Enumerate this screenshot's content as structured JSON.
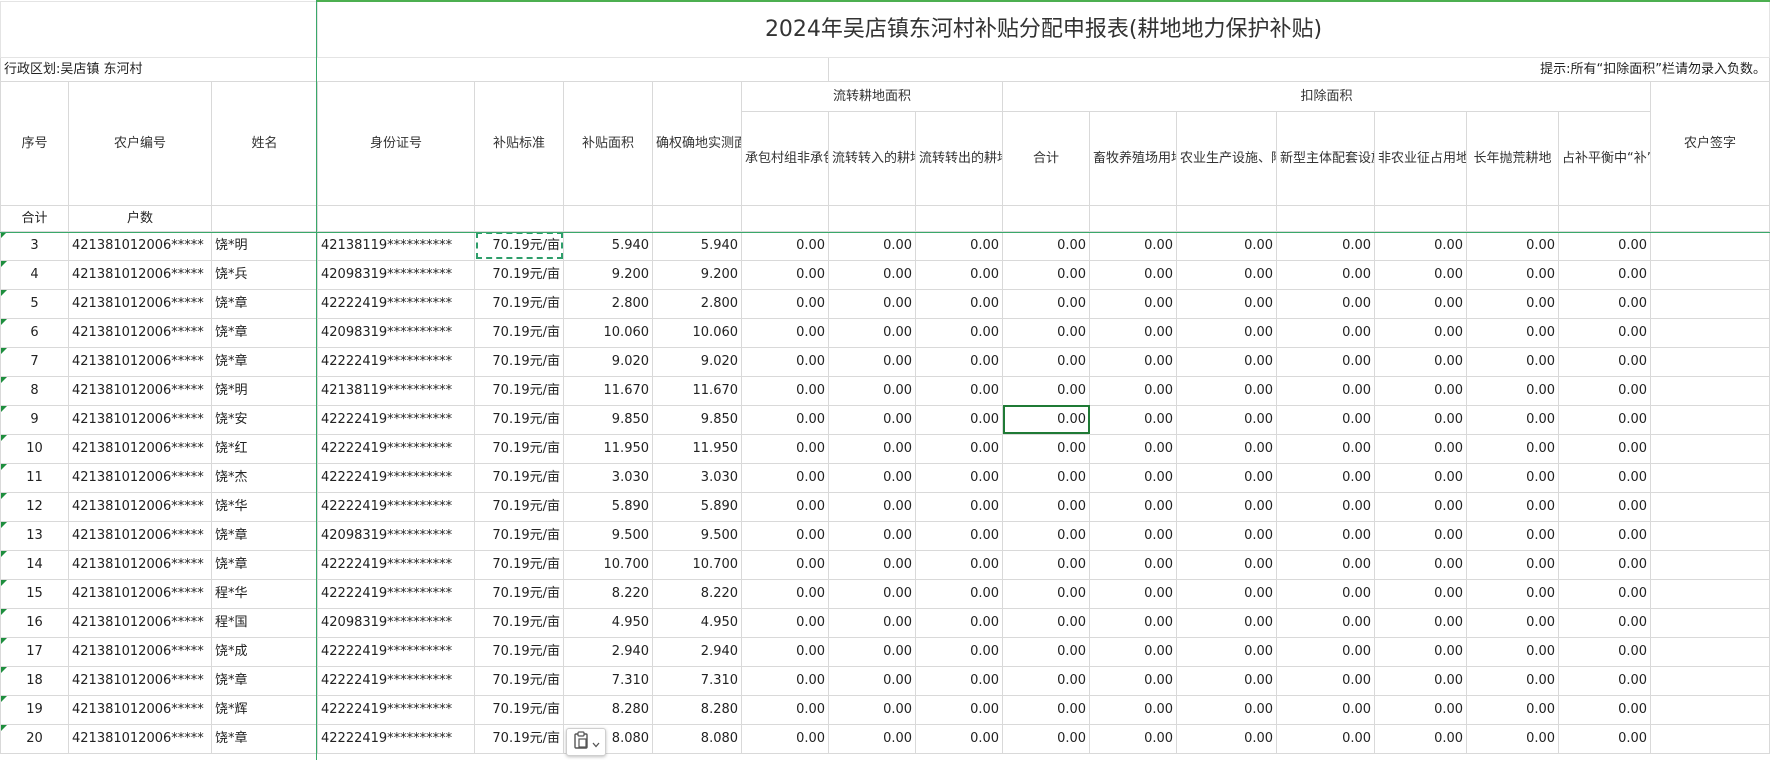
{
  "title": "2024年吴店镇东河村补贴分配申报表(耕地地力保护补贴)",
  "admin_region": "行政区划:吴店镇 东河村",
  "hint": "提示:所有“扣除面积”栏请勿录入负数。",
  "headers": {
    "seq": "序号",
    "farmer_code": "农户编号",
    "name": "姓名",
    "id_number": "身份证号",
    "subsidy_std": "补贴标准",
    "subsidy_area": "补贴面积",
    "measured_area": "确权确地实测面积",
    "transfer_group": "流转耕地面积",
    "transfer_cols": [
      "承包村组非承包地",
      "流转转入的耕地",
      "流转转出的耕地"
    ],
    "deduct_group": "扣除面积",
    "deduct_cols": [
      "合计",
      "畜牧养殖场用地",
      "农业生产设施、附属用地",
      "新型主体配套设施用地",
      "非农业征占用地",
      "长年抛荒耕地",
      "占补平衡中“补”的面积和质量达不到耕种条件的耕地"
    ],
    "signature": "农户签字"
  },
  "total_row": {
    "label": "合计",
    "households": "户数"
  },
  "rows": [
    {
      "seq": "3",
      "code": "421381012006*****",
      "name": "饶*明",
      "id": "42138119**********",
      "std": "70.19元/亩",
      "area": "5.940",
      "measured": "5.940"
    },
    {
      "seq": "4",
      "code": "421381012006*****",
      "name": "饶*兵",
      "id": "42098319**********",
      "std": "70.19元/亩",
      "area": "9.200",
      "measured": "9.200"
    },
    {
      "seq": "5",
      "code": "421381012006*****",
      "name": "饶*章",
      "id": "42222419**********",
      "std": "70.19元/亩",
      "area": "2.800",
      "measured": "2.800"
    },
    {
      "seq": "6",
      "code": "421381012006*****",
      "name": "饶*章",
      "id": "42098319**********",
      "std": "70.19元/亩",
      "area": "10.060",
      "measured": "10.060"
    },
    {
      "seq": "7",
      "code": "421381012006*****",
      "name": "饶*章",
      "id": "42222419**********",
      "std": "70.19元/亩",
      "area": "9.020",
      "measured": "9.020"
    },
    {
      "seq": "8",
      "code": "421381012006*****",
      "name": "饶*明",
      "id": "42138119**********",
      "std": "70.19元/亩",
      "area": "11.670",
      "measured": "11.670"
    },
    {
      "seq": "9",
      "code": "421381012006*****",
      "name": "饶*安",
      "id": "42222419**********",
      "std": "70.19元/亩",
      "area": "9.850",
      "measured": "9.850"
    },
    {
      "seq": "10",
      "code": "421381012006*****",
      "name": "饶*红",
      "id": "42222419**********",
      "std": "70.19元/亩",
      "area": "11.950",
      "measured": "11.950"
    },
    {
      "seq": "11",
      "code": "421381012006*****",
      "name": "饶*杰",
      "id": "42222419**********",
      "std": "70.19元/亩",
      "area": "3.030",
      "measured": "3.030"
    },
    {
      "seq": "12",
      "code": "421381012006*****",
      "name": "饶*华",
      "id": "42222419**********",
      "std": "70.19元/亩",
      "area": "5.890",
      "measured": "5.890"
    },
    {
      "seq": "13",
      "code": "421381012006*****",
      "name": "饶*章",
      "id": "42098319**********",
      "std": "70.19元/亩",
      "area": "9.500",
      "measured": "9.500"
    },
    {
      "seq": "14",
      "code": "421381012006*****",
      "name": "饶*章",
      "id": "42222419**********",
      "std": "70.19元/亩",
      "area": "10.700",
      "measured": "10.700"
    },
    {
      "seq": "15",
      "code": "421381012006*****",
      "name": "程*华",
      "id": "42222419**********",
      "std": "70.19元/亩",
      "area": "8.220",
      "measured": "8.220"
    },
    {
      "seq": "16",
      "code": "421381012006*****",
      "name": "程*国",
      "id": "42098319**********",
      "std": "70.19元/亩",
      "area": "4.950",
      "measured": "4.950"
    },
    {
      "seq": "17",
      "code": "421381012006*****",
      "name": "饶*成",
      "id": "42222419**********",
      "std": "70.19元/亩",
      "area": "2.940",
      "measured": "2.940"
    },
    {
      "seq": "18",
      "code": "421381012006*****",
      "name": "饶*章",
      "id": "42222419**********",
      "std": "70.19元/亩",
      "area": "7.310",
      "measured": "7.310"
    },
    {
      "seq": "19",
      "code": "421381012006*****",
      "name": "饶*辉",
      "id": "42222419**********",
      "std": "70.19元/亩",
      "area": "8.280",
      "measured": "8.280"
    },
    {
      "seq": "20",
      "code": "421381012006*****",
      "name": "饶*章",
      "id": "42222419**********",
      "std": "70.19元/亩",
      "area": "8.080",
      "measured": "8.080"
    }
  ],
  "zero_value": "0.00",
  "icons": {
    "paste_options": "clipboard-icon",
    "dropdown": "chevron-down-icon"
  },
  "colors": {
    "selection": "#1f7a35",
    "grid_line": "#3aa86a"
  }
}
